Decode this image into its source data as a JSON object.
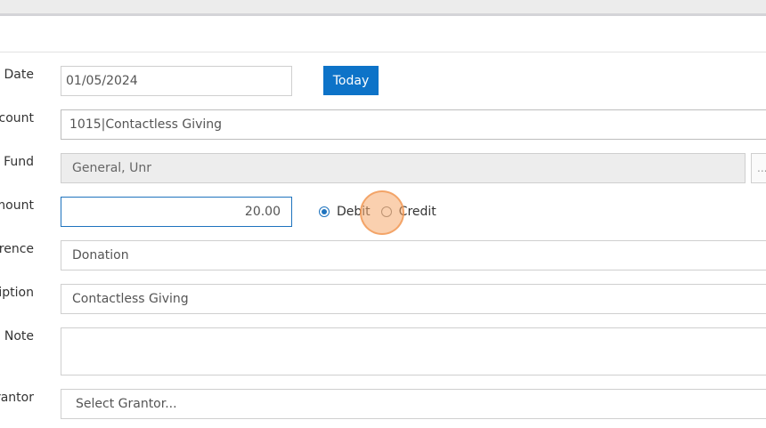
{
  "form": {
    "date": {
      "label": "Date",
      "value": "01/05/2024"
    },
    "today_button": "Today",
    "account": {
      "label": "ccount",
      "value": "1015|Contactless Giving"
    },
    "fund": {
      "label": "Fund",
      "value": "General, Unr",
      "browse": "..."
    },
    "amount": {
      "label": "mount",
      "value": "20.00",
      "options": [
        {
          "label": "Debit",
          "checked": true
        },
        {
          "label": "Credit",
          "checked": false
        }
      ]
    },
    "reference": {
      "label": "erence",
      "value": "Donation"
    },
    "description": {
      "label": "ription",
      "value": "Contactless Giving"
    },
    "note": {
      "label": "Note",
      "value": ""
    },
    "grantor": {
      "label": "rantor",
      "placeholder": "Select Grantor..."
    }
  },
  "colors": {
    "accent": "#0d73c8",
    "click_indicator": "#f6aa6e"
  }
}
